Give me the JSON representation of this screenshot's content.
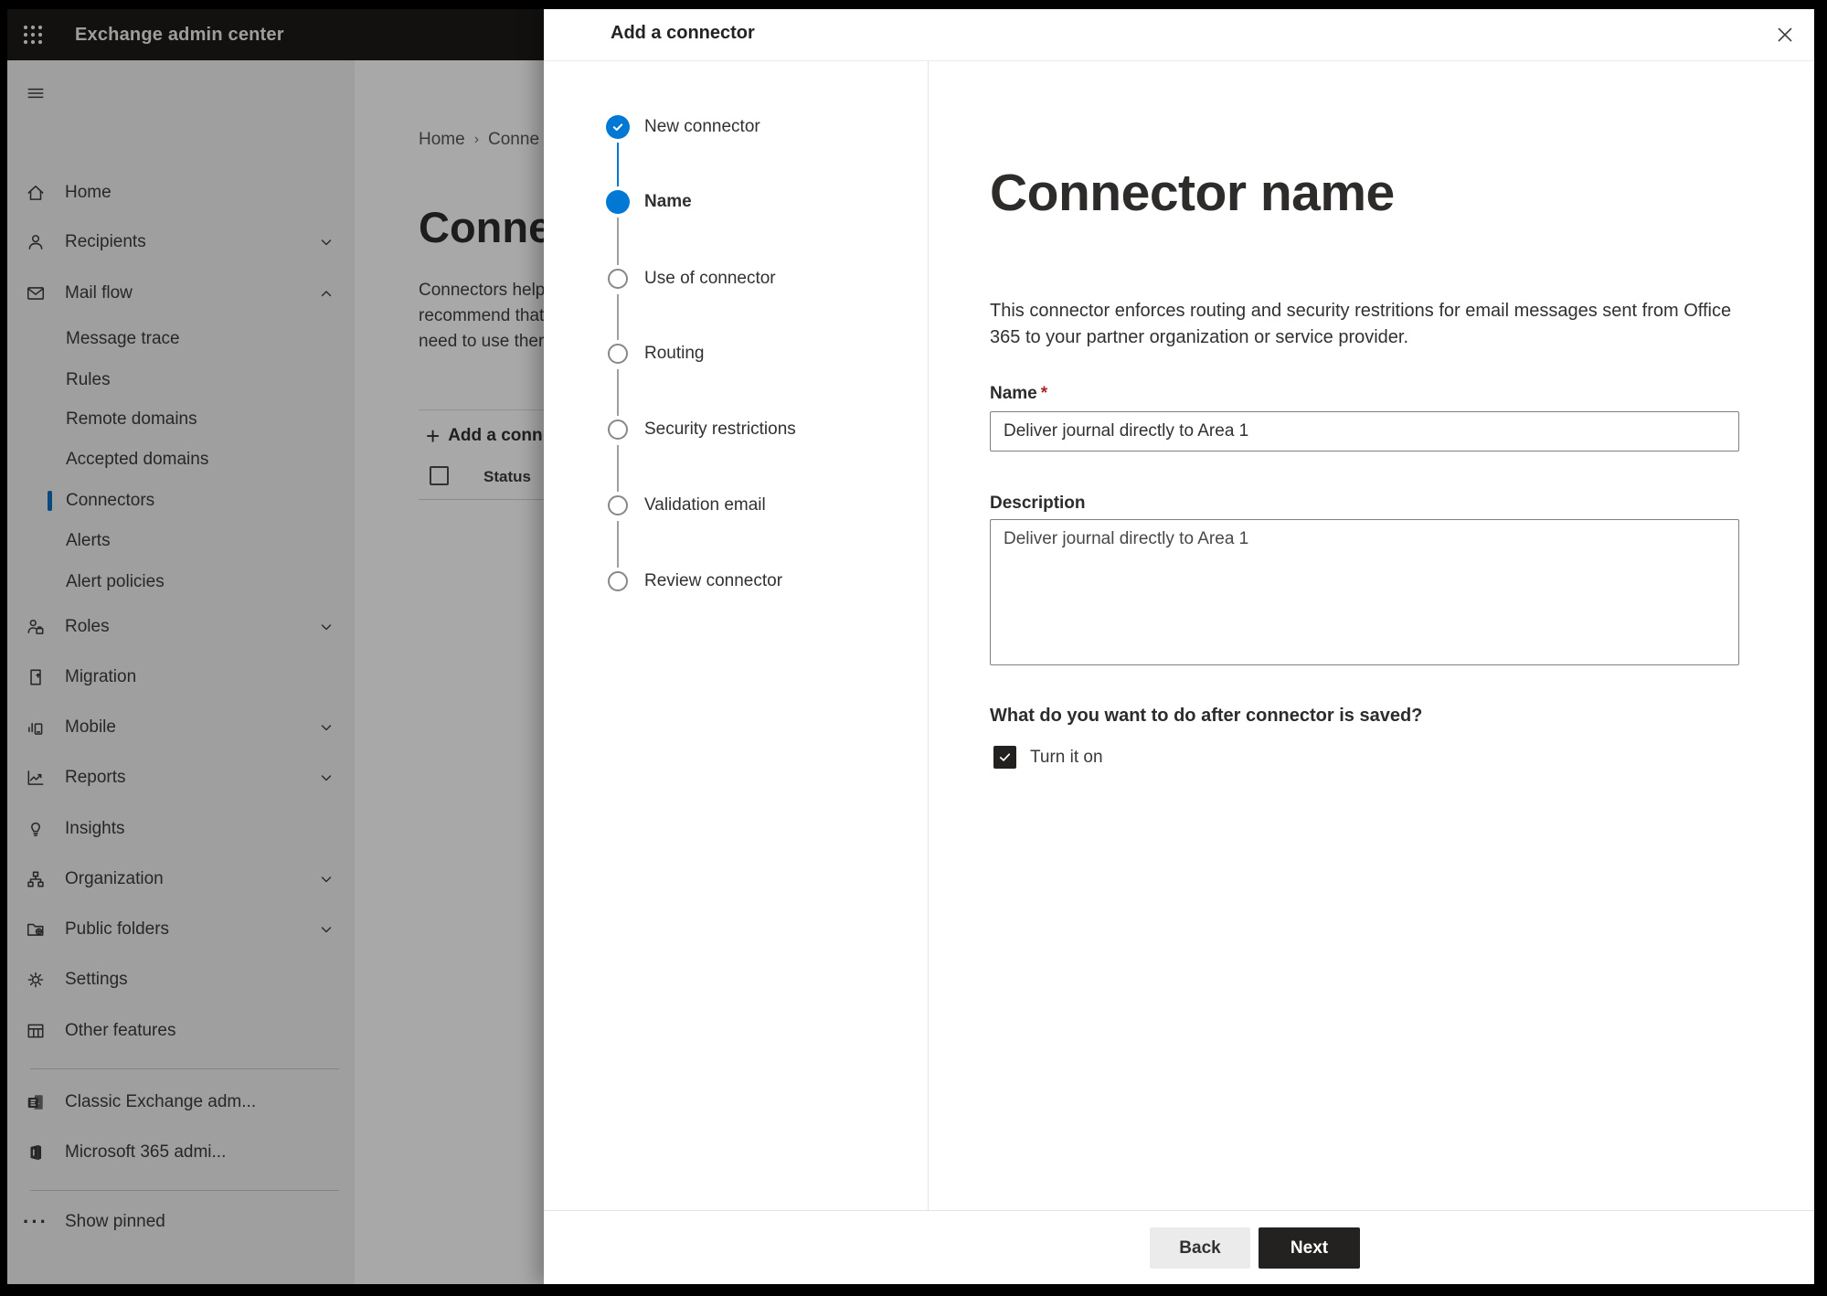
{
  "app": {
    "title": "Exchange admin center"
  },
  "colors": {
    "accent_blue": "#0078d4",
    "selected_marker": "#0f6cbd",
    "next_button": "#232221",
    "required_red": "#a4262c"
  },
  "sidebar": {
    "items": [
      {
        "label": "Home"
      },
      {
        "label": "Recipients"
      },
      {
        "label": "Mail flow"
      },
      {
        "label": "Message trace"
      },
      {
        "label": "Rules"
      },
      {
        "label": "Remote domains"
      },
      {
        "label": "Accepted domains"
      },
      {
        "label": "Connectors",
        "selected": true
      },
      {
        "label": "Alerts"
      },
      {
        "label": "Alert policies"
      },
      {
        "label": "Roles"
      },
      {
        "label": "Migration"
      },
      {
        "label": "Mobile"
      },
      {
        "label": "Reports"
      },
      {
        "label": "Insights"
      },
      {
        "label": "Organization"
      },
      {
        "label": "Public folders"
      },
      {
        "label": "Settings"
      },
      {
        "label": "Other features"
      },
      {
        "label": "Classic Exchange adm..."
      },
      {
        "label": "Microsoft 365 admi..."
      },
      {
        "label": "Show pinned"
      }
    ]
  },
  "page": {
    "breadcrumb": {
      "home": "Home",
      "current": "Conne"
    },
    "title": "Connec",
    "description_lines": {
      "l1": "Connectors help",
      "l2": "recommend that",
      "l3": "need to use ther"
    },
    "add_button": "Add a conn",
    "table": {
      "status_header": "Status"
    }
  },
  "dialog": {
    "title": "Add a connector",
    "steps": [
      {
        "label": "New connector",
        "state": "complete"
      },
      {
        "label": "Name",
        "state": "current"
      },
      {
        "label": "Use of connector",
        "state": "upcoming"
      },
      {
        "label": "Routing",
        "state": "upcoming"
      },
      {
        "label": "Security restrictions",
        "state": "upcoming"
      },
      {
        "label": "Validation email",
        "state": "upcoming"
      },
      {
        "label": "Review connector",
        "state": "upcoming"
      }
    ],
    "content": {
      "heading": "Connector name",
      "intro_line1": "This connector enforces routing and security restritions for email messages sent from Office 365",
      "intro_line2": "to your partner organization or service provider.",
      "name_label": "Name",
      "required_mark": "*",
      "name_value": "Deliver journal directly to Area 1",
      "description_label": "Description",
      "description_value": "Deliver journal directly to Area 1",
      "after_save_question": "What do you want to do after connector is saved?",
      "turn_on_label": "Turn it on",
      "turn_on_checked": true
    },
    "footer": {
      "back": "Back",
      "next": "Next"
    }
  }
}
